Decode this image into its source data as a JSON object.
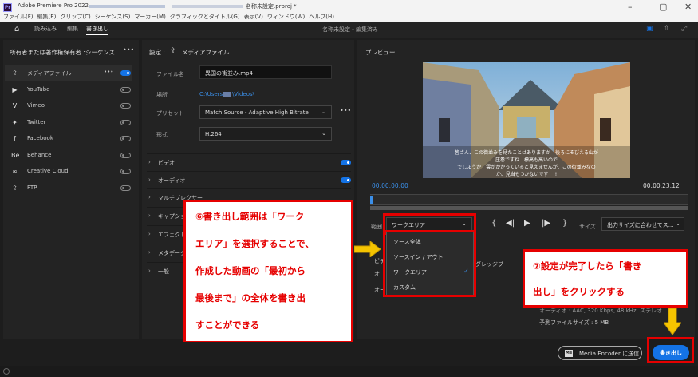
{
  "window": {
    "app_name": "Adobe Premiere Pro 2022",
    "project_file": "名称未設定.prproj *",
    "menu": [
      "ファイル(F)",
      "編集(E)",
      "クリップ(C)",
      "シーケンス(S)",
      "マーカー(M)",
      "グラフィックとタイトル(G)",
      "表示(V)",
      "ウィンドウ(W)",
      "ヘルプ(H)"
    ]
  },
  "topnav": {
    "tabs": [
      "読み込み",
      "編集",
      "書き出し"
    ],
    "active_tab": "書き出し",
    "center_title": "名称未設定 - 編集済み"
  },
  "left_panel": {
    "header": "所有者または著作権保有者 :シーケンス...",
    "destinations": [
      {
        "label": "メディアファイル",
        "icon": "export-icon",
        "on": true
      },
      {
        "label": "YouTube",
        "icon": "youtube-icon",
        "on": false
      },
      {
        "label": "Vimeo",
        "icon": "vimeo-icon",
        "on": false
      },
      {
        "label": "Twitter",
        "icon": "twitter-icon",
        "on": false
      },
      {
        "label": "Facebook",
        "icon": "facebook-icon",
        "on": false
      },
      {
        "label": "Behance",
        "icon": "behance-icon",
        "on": false
      },
      {
        "label": "Creative Cloud",
        "icon": "creative-cloud-icon",
        "on": false
      },
      {
        "label": "FTP",
        "icon": "ftp-icon",
        "on": false
      }
    ]
  },
  "settings": {
    "title": "設定 :",
    "subtitle": "メディアファイル",
    "filename_label": "ファイル名",
    "filename_value": "異国の街並み.mp4",
    "location_label": "場所",
    "location_path1": "C:\\Users\\",
    "location_path2": "\\Videos\\",
    "preset_label": "プリセット",
    "preset_value": "Match Source - Adaptive High Bitrate",
    "format_label": "形式",
    "format_value": "H.264",
    "sections": [
      "ビデオ",
      "オーディオ",
      "マルチプレクサー",
      "キャプション",
      "エフェクト",
      "メタデータ",
      "一般"
    ]
  },
  "preview": {
    "title": "プレビュー",
    "subtitles": [
      "皆さん、この街並みを見たことはありますか　後ろにそびえる山が",
      "圧巻ですね　標高も高いので",
      "でしょうか　雲がかかっていると見えませんが、この街並みなの",
      "か、見当もつかないです　!!"
    ],
    "timecode_start": "00:00:00:00",
    "timecode_end": "00:00:23:12",
    "range_label": "範囲",
    "range_value": "ワークエリア",
    "size_label": "サイズ",
    "size_value": "出力サイズに合わせてス...",
    "range_options": [
      "ソース全体",
      "ソースイン / アウト",
      "ワークエリア",
      "カスタム"
    ],
    "selected_option": "ワークエリア",
    "hidden_partial_1": "ビデ",
    "hidden_partial_2": "オ",
    "hidden_partial_3": "オー",
    "hidden_partial_4": "グレッジブ",
    "audio_line": "オーディオ : AAC, 320 Kbps, 48 kHz, ステレオ",
    "estimated_size": "予測ファイルサイズ : 5 MB"
  },
  "bottom": {
    "media_encoder_button": "Media Encoder に送信",
    "export_button": "書き出し"
  },
  "annotations": {
    "callout_left": [
      "⑥書き出し範囲は「ワーク",
      "エリア」を選択することで、",
      "作成した動画の「最初から",
      "最後まで」の全体を書き出",
      "すことができる"
    ],
    "callout_right": [
      "⑦設定が完了したら「書き",
      "出し」をクリックする"
    ]
  },
  "colors": {
    "accent_blue": "#1473e6",
    "annotation_red": "#e60000",
    "annotation_arrow": "#f5c400"
  }
}
